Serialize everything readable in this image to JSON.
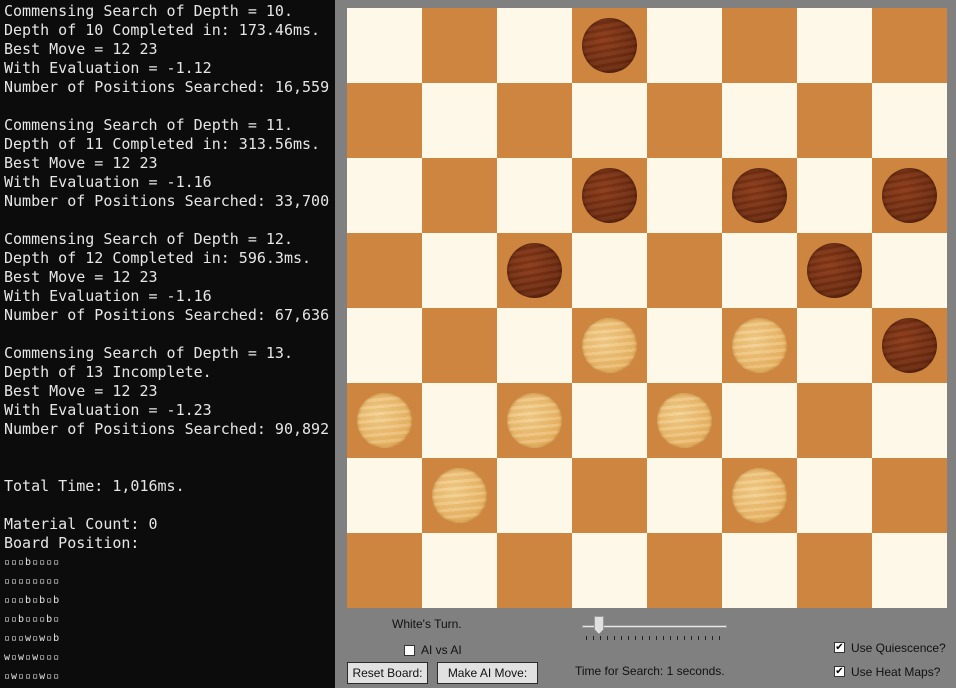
{
  "console": {
    "lines": [
      "Commensing Search of Depth = 10.",
      "Depth of 10 Completed in: 173.46ms.",
      "Best Move = 12 23",
      "With Evaluation = -1.12",
      "Number of Positions Searched: 16,559",
      "",
      "Commensing Search of Depth = 11.",
      "Depth of 11 Completed in: 313.56ms.",
      "Best Move = 12 23",
      "With Evaluation = -1.16",
      "Number of Positions Searched: 33,700",
      "",
      "Commensing Search of Depth = 12.",
      "Depth of 12 Completed in: 596.3ms.",
      "Best Move = 12 23",
      "With Evaluation = -1.16",
      "Number of Positions Searched: 67,636",
      "",
      "Commensing Search of Depth = 13.",
      "Depth of 13 Incomplete.",
      "Best Move = 12 23",
      "With Evaluation = -1.23",
      "Number of Positions Searched: 90,892",
      "",
      "",
      "Total Time: 1,016ms.",
      "",
      "Material Count: 0",
      "Board Position:"
    ],
    "board_lines": [
      "▫▫▫b▫▫▫▫",
      "▫▫▫▫▫▫▫▫",
      "▫▫▫b▫b▫b",
      "▫▫b▫▫▫b▫",
      "▫▫▫w▫w▫b",
      "w▫w▫w▫▫▫",
      "▫w▫▫▫w▫▫"
    ]
  },
  "board": {
    "colors": {
      "light": "#fdf8e8",
      "dark": "#cd853f"
    },
    "rows": [
      "...b....",
      "........",
      "...b.b.b",
      "..b...b.",
      "...w.w.b",
      "w.w.w...",
      ".w...w..",
      "........"
    ]
  },
  "controls": {
    "turn_text": "White's Turn.",
    "ai_vs_ai_label": "AI vs AI",
    "ai_vs_ai_checked": false,
    "reset_button": "Reset Board:",
    "make_ai_move_button": "Make AI Move:",
    "time_for_search": "Time for Search: 1 seconds.",
    "slider_value": 1,
    "use_quiescence_label": "Use Quiescence?",
    "use_quiescence_checked": true,
    "use_heat_maps_label": "Use Heat Maps?",
    "use_heat_maps_checked": true
  }
}
